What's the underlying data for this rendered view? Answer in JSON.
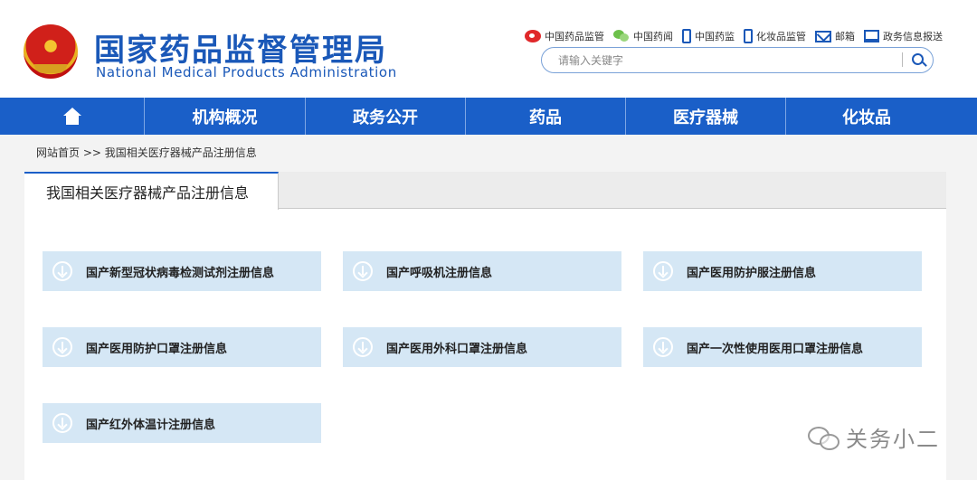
{
  "header": {
    "title_cn": "国家药品监督管理局",
    "title_en": "National Medical Products Administration",
    "links": [
      {
        "label": "中国药品监管",
        "icon": "weibo-icon"
      },
      {
        "label": "中国药闻",
        "icon": "wechat-icon"
      },
      {
        "label": "中国药监",
        "icon": "mobile-icon"
      },
      {
        "label": "化妆品监管",
        "icon": "mobile-icon"
      },
      {
        "label": "邮箱",
        "icon": "mail-icon"
      },
      {
        "label": "政务信息报送",
        "icon": "report-icon"
      }
    ],
    "search": {
      "placeholder": "请输入关键字",
      "value": ""
    }
  },
  "nav": {
    "home_icon": "home-icon",
    "items": [
      "机构概况",
      "政务公开",
      "药品",
      "医疗器械",
      "化妆品"
    ]
  },
  "breadcrumb": "网站首页 >> 我国相关医疗器械产品注册信息",
  "tab": {
    "active_label": "我国相关医疗器械产品注册信息"
  },
  "cards": [
    "国产新型冠状病毒检测试剂注册信息",
    "国产呼吸机注册信息",
    "国产医用防护服注册信息",
    "国产医用防护口罩注册信息",
    "国产医用外科口罩注册信息",
    "国产一次性使用医用口罩注册信息",
    "国产红外体温计注册信息"
  ],
  "watermark": "关务小二",
  "colors": {
    "brand": "#1a5fc8",
    "card_bg": "#d5e7f5",
    "weibo": "#e0282a",
    "wechat": "#6cc04a"
  }
}
